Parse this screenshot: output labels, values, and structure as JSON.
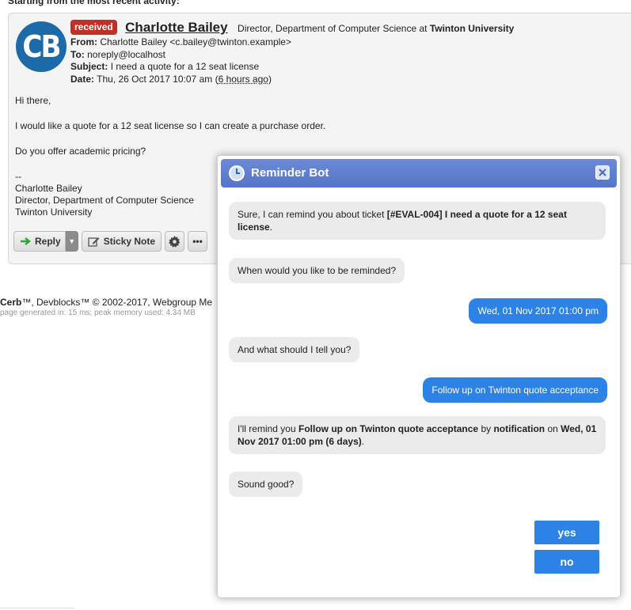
{
  "page": {
    "heading": "Starting from the most recent activity:"
  },
  "message": {
    "avatar_initials": "CB",
    "badge": "received",
    "sender_name": "Charlotte Bailey",
    "sender_title": "Director, Department of Computer Science at",
    "sender_org": "Twinton University",
    "from_label": "From:",
    "from_value": "Charlotte Bailey <c.bailey@twinton.example>",
    "to_label": "To:",
    "to_value": "noreply@localhost",
    "subject_label": "Subject:",
    "subject_value": "I need a quote for a 12 seat license",
    "date_label": "Date:",
    "date_value": "Thu, 26 Oct 2017 10:07 am (",
    "date_ago": "6 hours ago",
    "date_close": ")",
    "body": [
      "Hi there,",
      "I would like a quote for a 12 seat license so I can create a purchase order.",
      "Do you offer academic pricing?"
    ],
    "signature": [
      "--",
      "Charlotte Bailey",
      "Director, Department of Computer Science",
      "Twinton University"
    ],
    "actions": {
      "reply": "Reply",
      "sticky_note": "Sticky Note",
      "more": "•••"
    }
  },
  "footer": {
    "brand": "Cerb",
    "text": "™, Devblocks™ © 2002-2017, Webgroup Me",
    "sub": "page generated in: 15 ms; peak memory used: 4.34 MB"
  },
  "bot": {
    "title": "Reminder Bot",
    "messages": {
      "m1_pre": "Sure, I can remind you about ticket ",
      "m1_bold": "[#EVAL-004] I need a quote for a 12 seat license",
      "m1_post": ".",
      "m2": "When would you like to be reminded?",
      "u1": "Wed, 01 Nov 2017 01:00 pm",
      "m3": "And what should I tell you?",
      "u2": "Follow up on Twinton quote acceptance",
      "m4_a": "I'll remind you ",
      "m4_b": "Follow up on Twinton quote acceptance",
      "m4_c": " by ",
      "m4_d": "notification",
      "m4_e": " on ",
      "m4_f": "Wed, 01 Nov 2017 01:00 pm (6 days)",
      "m4_g": ".",
      "m5": "Sound good?"
    },
    "choices": {
      "yes": "yes",
      "no": "no"
    }
  },
  "colors": {
    "accent": "#2d82e6",
    "titlebar": "#5b78cc",
    "badge": "#c32f25",
    "avatar": "#1d6aa8"
  }
}
